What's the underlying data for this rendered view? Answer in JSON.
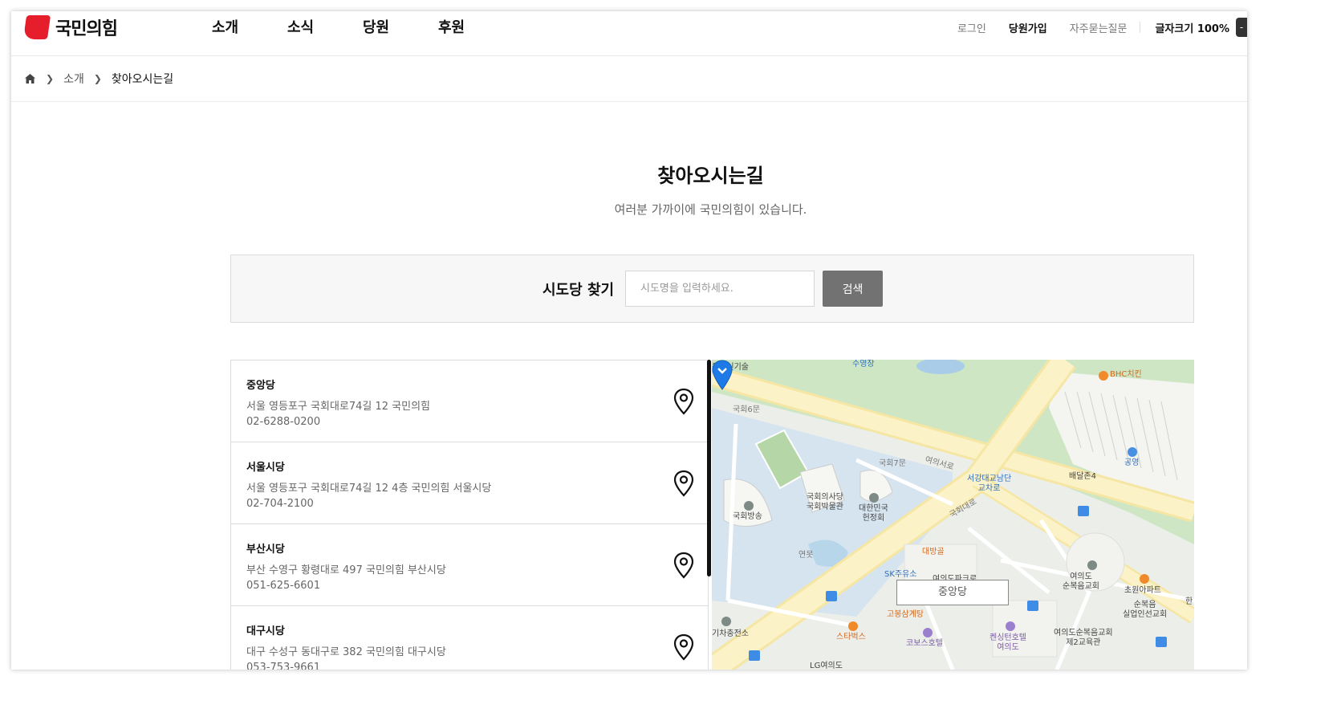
{
  "header": {
    "logo_text": "국민의힘",
    "nav": [
      "소개",
      "소식",
      "당원",
      "후원"
    ],
    "util": {
      "login": "로그인",
      "join": "당원가입",
      "faq": "자주묻는질문",
      "font_size_label": "글자크기 100%"
    }
  },
  "breadcrumb": {
    "home_icon": "home-icon",
    "items": [
      "소개",
      "찾아오시는길"
    ]
  },
  "page": {
    "title": "찾아오시는길",
    "subtitle": "여러분 가까이에 국민의힘이 있습니다."
  },
  "search": {
    "label": "시도당 찾기",
    "placeholder": "시도명을 입력하세요.",
    "button": "검색"
  },
  "offices": [
    {
      "name": "중앙당",
      "address": "서울 영등포구 국회대로74길 12 국민의힘",
      "tel": "02-6288-0200"
    },
    {
      "name": "서울시당",
      "address": "서울 영등포구 국회대로74길 12 4층 국민의힘 서울시당",
      "tel": "02-704-2100"
    },
    {
      "name": "부산시당",
      "address": "부산 수영구 황령대로 497 국민의힘 부산시당",
      "tel": "051-625-6601"
    },
    {
      "name": "대구시당",
      "address": "대구 수성구 동대구로 382 국민의힘 대구시당",
      "tel": "053-753-9661"
    }
  ],
  "map": {
    "marker_label": "중앙당",
    "labels": {
      "l1": "동방신기술",
      "l2": "수영장",
      "l3": "BHC치킨",
      "l4": "국회6문",
      "l5": "국회7문",
      "l6": "여의서로",
      "l7": "서강대교남단\n교차로",
      "l8": "공영",
      "l9": "배달존4",
      "l10": "국회의사당\n국회박물관",
      "l11": "대한민국\n헌정회",
      "l12": "국회방송",
      "l13": "국회대로",
      "l14": "대방골",
      "l15": "연못",
      "l16": "SK주유소",
      "l17": "여의도파크로",
      "l18": "여의도\n순복음교회",
      "l19": "초원아파트",
      "l20": "순복음\n실업인선교회",
      "l21": "고봉삼계탕",
      "l22": "스타벅스",
      "l23": "코보스호텔",
      "l24": "켄싱턴호텔\n여의도",
      "l25": "여의도순복음교회\n제2교육관",
      "l26": "기차충전소",
      "l27": "LG여의도",
      "l28": "한"
    }
  },
  "colors": {
    "brand_red": "#e61e2b",
    "search_button": "#727272",
    "map_marker": "#1e7ae6"
  }
}
